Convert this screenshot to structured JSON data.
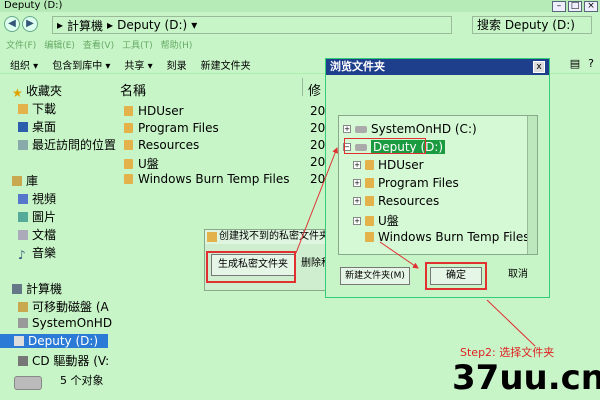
{
  "window": {
    "title": "Deputy (D:)",
    "address": [
      "計算機",
      "Deputy (D:)"
    ],
    "search_placeholder": "搜索 Deputy (D:)"
  },
  "menu": [
    "文件(F)",
    "编辑(E)",
    "查看(V)",
    "工具(T)",
    "帮助(H)"
  ],
  "toolbar": [
    "组织 ▾",
    "包含到库中 ▾",
    "共享 ▾",
    "刻录",
    "新建文件夹"
  ],
  "sidebar": {
    "favorites": "收藏夾",
    "fav_items": [
      "下載",
      "桌面",
      "最近訪問的位置"
    ],
    "library": "庫",
    "lib_items": [
      "視頻",
      "圖片",
      "文檔",
      "音樂"
    ],
    "computer": "計算機",
    "comp_items": [
      "可移動磁盤 (A",
      "SystemOnHD",
      "Deputy (D:)",
      "CD 驅動器 (V:"
    ],
    "selected": "Deputy (D:)"
  },
  "files": {
    "col_name": "名稱",
    "col_modified": "修",
    "items": [
      {
        "name": "HDUser",
        "date": "20"
      },
      {
        "name": "Program Files",
        "date": "20"
      },
      {
        "name": "Resources",
        "date": "20"
      },
      {
        "name": "U盤",
        "date": "20"
      },
      {
        "name": "Windows Burn Temp Files",
        "date": "20"
      }
    ]
  },
  "status": "5 个对象",
  "small_dialog": {
    "title": "创建找不到的私密文件夹",
    "gen_button": "生成私密文件夹",
    "del_button": "删除私"
  },
  "browse_dialog": {
    "title": "浏览文件夹",
    "close": "x",
    "tree": [
      {
        "label": "SystemOnHD (C:)",
        "type": "drive",
        "level": 0
      },
      {
        "label": "Deputy (D:)",
        "type": "drive",
        "level": 0,
        "selected": true
      },
      {
        "label": "HDUser",
        "type": "folder",
        "level": 1
      },
      {
        "label": "Program Files",
        "type": "folder",
        "level": 1
      },
      {
        "label": "Resources",
        "type": "folder",
        "level": 1
      },
      {
        "label": "U盤",
        "type": "folder",
        "level": 1
      },
      {
        "label": "Windows Burn Temp Files",
        "type": "folder",
        "level": 1
      }
    ],
    "new_folder_button": "新建文件夹(M)",
    "ok_button": "确定",
    "cancel_button": "取消"
  },
  "annotation": {
    "step2": "Step2: 选择文件夹",
    "watermark": "37uu.cn"
  },
  "colors": {
    "accent_red": "#e03030",
    "tree_selected": "#1a9b40",
    "sidebar_selected": "#2b7bd6",
    "dialog_title": "#1e3f8c",
    "background": "#c8f5c8"
  }
}
